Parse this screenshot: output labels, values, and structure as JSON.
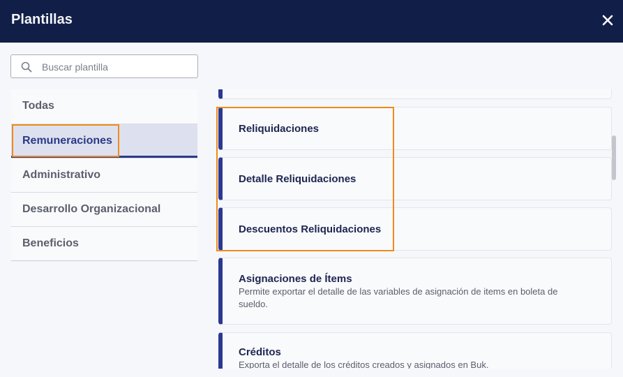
{
  "window": {
    "title": "Plantillas"
  },
  "search": {
    "placeholder": "Buscar plantilla",
    "value": ""
  },
  "categories": [
    {
      "label": "Todas",
      "active": false
    },
    {
      "label": "Remuneraciones",
      "active": true
    },
    {
      "label": "Administrativo",
      "active": false
    },
    {
      "label": "Desarrollo Organizacional",
      "active": false
    },
    {
      "label": "Beneficios",
      "active": false
    }
  ],
  "templates": [
    {
      "title": "Reliquidaciones",
      "description": ""
    },
    {
      "title": "Detalle Reliquidaciones",
      "description": ""
    },
    {
      "title": "Descuentos Reliquidaciones",
      "description": ""
    },
    {
      "title": "Asignaciones de Ítems",
      "description": "Permite exportar el detalle de las variables de asignación de items en boleta de sueldo."
    },
    {
      "title": "Créditos",
      "description": "Exporta el detalle de los créditos creados y asignados en Buk."
    }
  ],
  "icons": {
    "close": "close-icon",
    "search": "search-icon"
  },
  "colors": {
    "header": "#111f48",
    "accent": "#2b3990",
    "highlight": "#f08a1d"
  }
}
